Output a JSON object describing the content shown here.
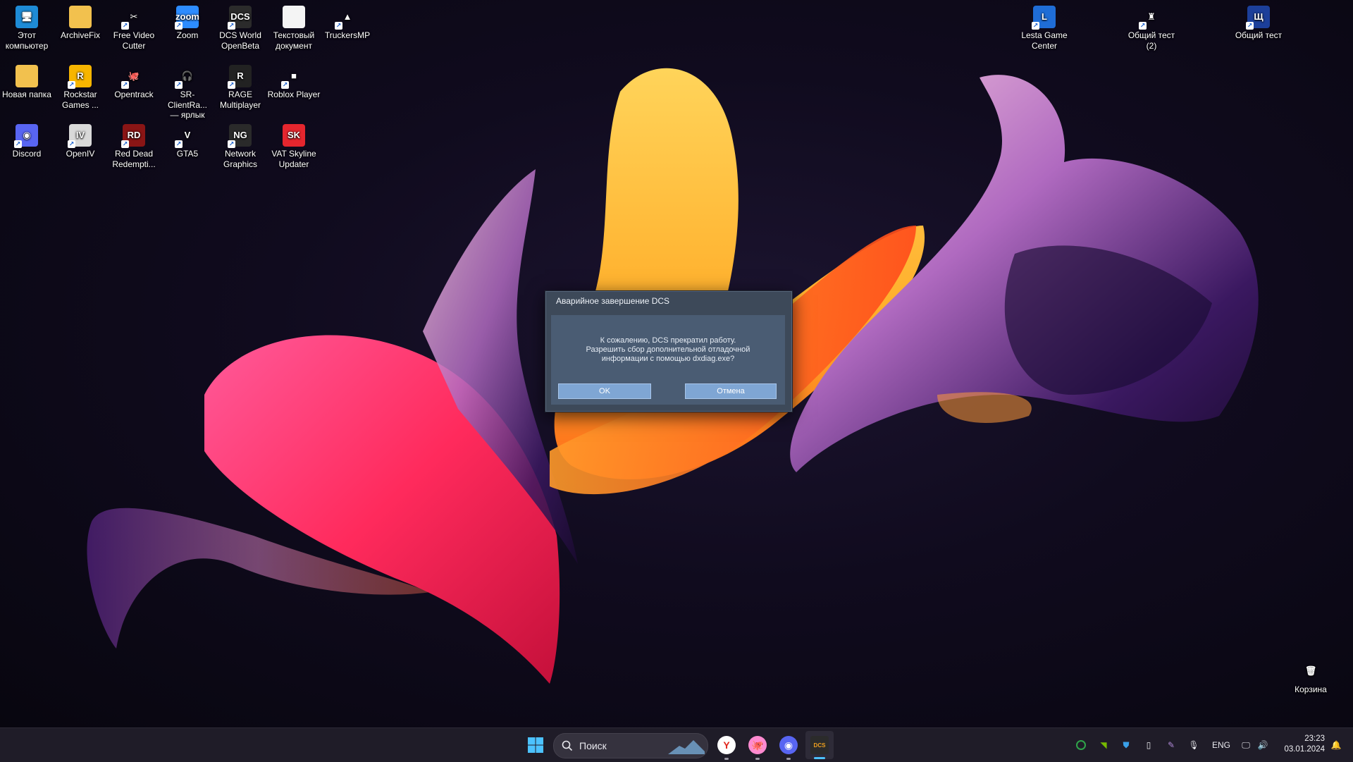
{
  "desktop_icons": [
    {
      "name": "this-pc-icon",
      "label": "Этот\nкомпьютер",
      "glyph": "🖥",
      "bg": "#1e8bd6",
      "shortcut": false
    },
    {
      "name": "archivefix-icon",
      "label": "ArchiveFix",
      "glyph": "",
      "bg": "#f2c14e",
      "shortcut": false
    },
    {
      "name": "free-video-cutter-icon",
      "label": "Free Video\nCutter",
      "glyph": "✂",
      "bg": "transparent",
      "shortcut": true
    },
    {
      "name": "zoom-icon",
      "label": "Zoom",
      "glyph": "zoom",
      "bg": "#2d8cff",
      "shortcut": true
    },
    {
      "name": "dcs-world-icon",
      "label": "DCS World\nOpenBeta",
      "glyph": "DCS",
      "bg": "#2b2b2b",
      "shortcut": true
    },
    {
      "name": "text-document-icon",
      "label": "Текстовый\nдокумент",
      "glyph": "",
      "bg": "#f4f4f4",
      "shortcut": false
    },
    {
      "name": "truckersmp-icon",
      "label": "TruckersMP",
      "glyph": "▲",
      "bg": "transparent",
      "shortcut": true
    },
    {
      "name": "new-folder-icon",
      "label": "Новая папка",
      "glyph": "",
      "bg": "#f2c14e",
      "shortcut": false
    },
    {
      "name": "rockstar-games-icon",
      "label": "Rockstar\nGames ...",
      "glyph": "R",
      "bg": "#f7b500",
      "shortcut": true
    },
    {
      "name": "opentrack-icon",
      "label": "Opentrack",
      "glyph": "🐙",
      "bg": "transparent",
      "shortcut": true
    },
    {
      "name": "sr-client-icon",
      "label": "SR-ClientRa...\n— ярлык",
      "glyph": "🎧",
      "bg": "transparent",
      "shortcut": true
    },
    {
      "name": "rage-multiplayer-icon",
      "label": "RAGE\nMultiplayer",
      "glyph": "R",
      "bg": "#222",
      "shortcut": true
    },
    {
      "name": "roblox-player-icon",
      "label": "Roblox Player",
      "glyph": "■",
      "bg": "transparent",
      "shortcut": true
    },
    {
      "name": "discord-icon",
      "label": "Discord",
      "glyph": "◉",
      "bg": "#5865f2",
      "shortcut": true
    },
    {
      "name": "openiv-icon",
      "label": "OpenIV",
      "glyph": "IV",
      "bg": "#d9d9d9",
      "shortcut": true
    },
    {
      "name": "red-dead-redemption-icon",
      "label": "Red Dead\nRedempti...",
      "glyph": "RD",
      "bg": "#8a1515",
      "shortcut": true
    },
    {
      "name": "gta5-icon",
      "label": "GTA5",
      "glyph": "V",
      "bg": "transparent",
      "shortcut": true
    },
    {
      "name": "network-graphics-icon",
      "label": "Network\nGraphics",
      "glyph": "NG",
      "bg": "#2a2a2a",
      "shortcut": true
    },
    {
      "name": "vat-skyline-updater-icon",
      "label": "VAT Skyline\nUpdater",
      "glyph": "SK",
      "bg": "#e5262e",
      "shortcut": false
    },
    {
      "name": "lesta-game-center-icon",
      "label": "Lesta Game\nCenter",
      "glyph": "L",
      "bg": "#1f6dd6",
      "shortcut": true
    },
    {
      "name": "shared-test-2-icon",
      "label": "Общий тест\n(2)",
      "glyph": "♜",
      "bg": "transparent",
      "shortcut": true
    },
    {
      "name": "shared-test-icon",
      "label": "Общий тест",
      "glyph": "Щ",
      "bg": "#1c3f9a",
      "shortcut": true
    },
    {
      "name": "recycle-bin-icon",
      "label": "Корзина",
      "glyph": "🗑",
      "bg": "transparent",
      "shortcut": false
    }
  ],
  "dialog": {
    "title": "Аварийное завершение DCS",
    "message": "К сожалению, DCS прекратил работу.\nРазрешить сбор дополнительной отладочной\nинформации с помощью dxdiag.exe?",
    "ok_label": "OK",
    "cancel_label": "Отмена"
  },
  "taskbar": {
    "search_placeholder": "Поиск",
    "apps": [
      {
        "name": "yandex-browser-taskbar-icon",
        "glyph": "Y"
      },
      {
        "name": "opentrack-taskbar-icon",
        "glyph": "🐙"
      },
      {
        "name": "discord-taskbar-icon",
        "glyph": "◉"
      },
      {
        "name": "dcs-taskbar-icon",
        "glyph": "DCS"
      }
    ],
    "language": "ENG",
    "time": "23:23",
    "date": "03.01.2024"
  }
}
